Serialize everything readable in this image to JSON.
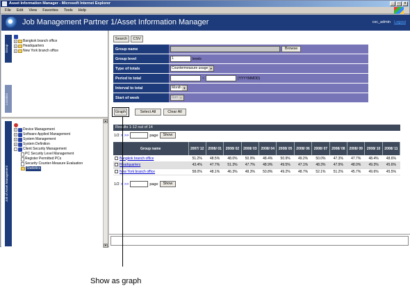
{
  "window": {
    "title": "Asset Information Manager - Microsoft Internet Explorer"
  },
  "menu": [
    "File",
    "Edit",
    "View",
    "Favorites",
    "Tools",
    "Help"
  ],
  "header": {
    "title": "Job Management Partner 1/Asset Information Manager",
    "user": "csc_admin",
    "logout": "Logout"
  },
  "left": {
    "tab_upper": "Group",
    "tab_upper2": "Location",
    "tab_lower": "Job of Asset Management",
    "upper_tree": [
      "Bangkok branch office",
      "Headquarters",
      "New York branch office"
    ],
    "lower_tree": [
      {
        "label": "Device Management",
        "level": 0
      },
      {
        "label": "Software Applied Management",
        "level": 0
      },
      {
        "label": "System Management",
        "level": 0
      },
      {
        "label": "System Definition",
        "level": 0
      },
      {
        "label": "Client Security Management",
        "level": 0
      },
      {
        "label": "PC Security Level Management",
        "level": 1
      },
      {
        "label": "Register Permitted PCs",
        "level": 1
      },
      {
        "label": "Security Counter-Measure Evaluation",
        "level": 1
      },
      {
        "label": "Statistics",
        "level": 1,
        "selected": true
      }
    ]
  },
  "toolbar": {
    "search": "Search",
    "csv": "CSV"
  },
  "form": {
    "group_name": "Group name",
    "browse": "Browse",
    "group_level": "Group level",
    "group_level_value": "1",
    "levels": "levels",
    "type_of_totals": "Type of totals",
    "type_value": "Countermeasure usage",
    "period": "Period to total",
    "period_hint": "(YYYYMMDD)",
    "interval": "Interval to total",
    "interval_value": "Month",
    "start_week": "Start of week",
    "start_week_value": "Sun"
  },
  "actions": {
    "graph": "Graph",
    "select_all": "Select All",
    "clear_all": "Clear All"
  },
  "results": {
    "summary": "Results 1-12 out of 14",
    "page": "1/2",
    "next": ">",
    "last": ">>",
    "page_label": "page",
    "show": "Show",
    "col_group": "Group name",
    "periods": [
      "2007/ 12",
      "2008/ 01",
      "2008/ 02",
      "2008/ 03",
      "2008/ 04",
      "2008/ 05",
      "2008/ 06",
      "2008/ 07",
      "2008/ 08",
      "2008/ 09",
      "2008/ 10",
      "2008/ 11"
    ],
    "rows": [
      {
        "name": "Bangkok branch office",
        "values": [
          "51.2%",
          "48.5%",
          "48.0%",
          "50.9%",
          "48.4%",
          "50.9%",
          "49.2%",
          "50.0%",
          "47.3%",
          "47.7%",
          "48.4%",
          "48.6%"
        ]
      },
      {
        "name": "Headquarters",
        "values": [
          "43.4%",
          "47.7%",
          "51.3%",
          "47.7%",
          "48.9%",
          "49.5%",
          "47.1%",
          "48.3%",
          "47.9%",
          "48.0%",
          "49.3%",
          "45.6%"
        ]
      },
      {
        "name": "New York branch office",
        "values": [
          "58.0%",
          "48.1%",
          "46.3%",
          "48.3%",
          "50.8%",
          "49.2%",
          "48.7%",
          "52.1%",
          "51.2%",
          "45.7%",
          "49.6%",
          "45.5%"
        ]
      }
    ]
  },
  "callout": "Show as graph"
}
